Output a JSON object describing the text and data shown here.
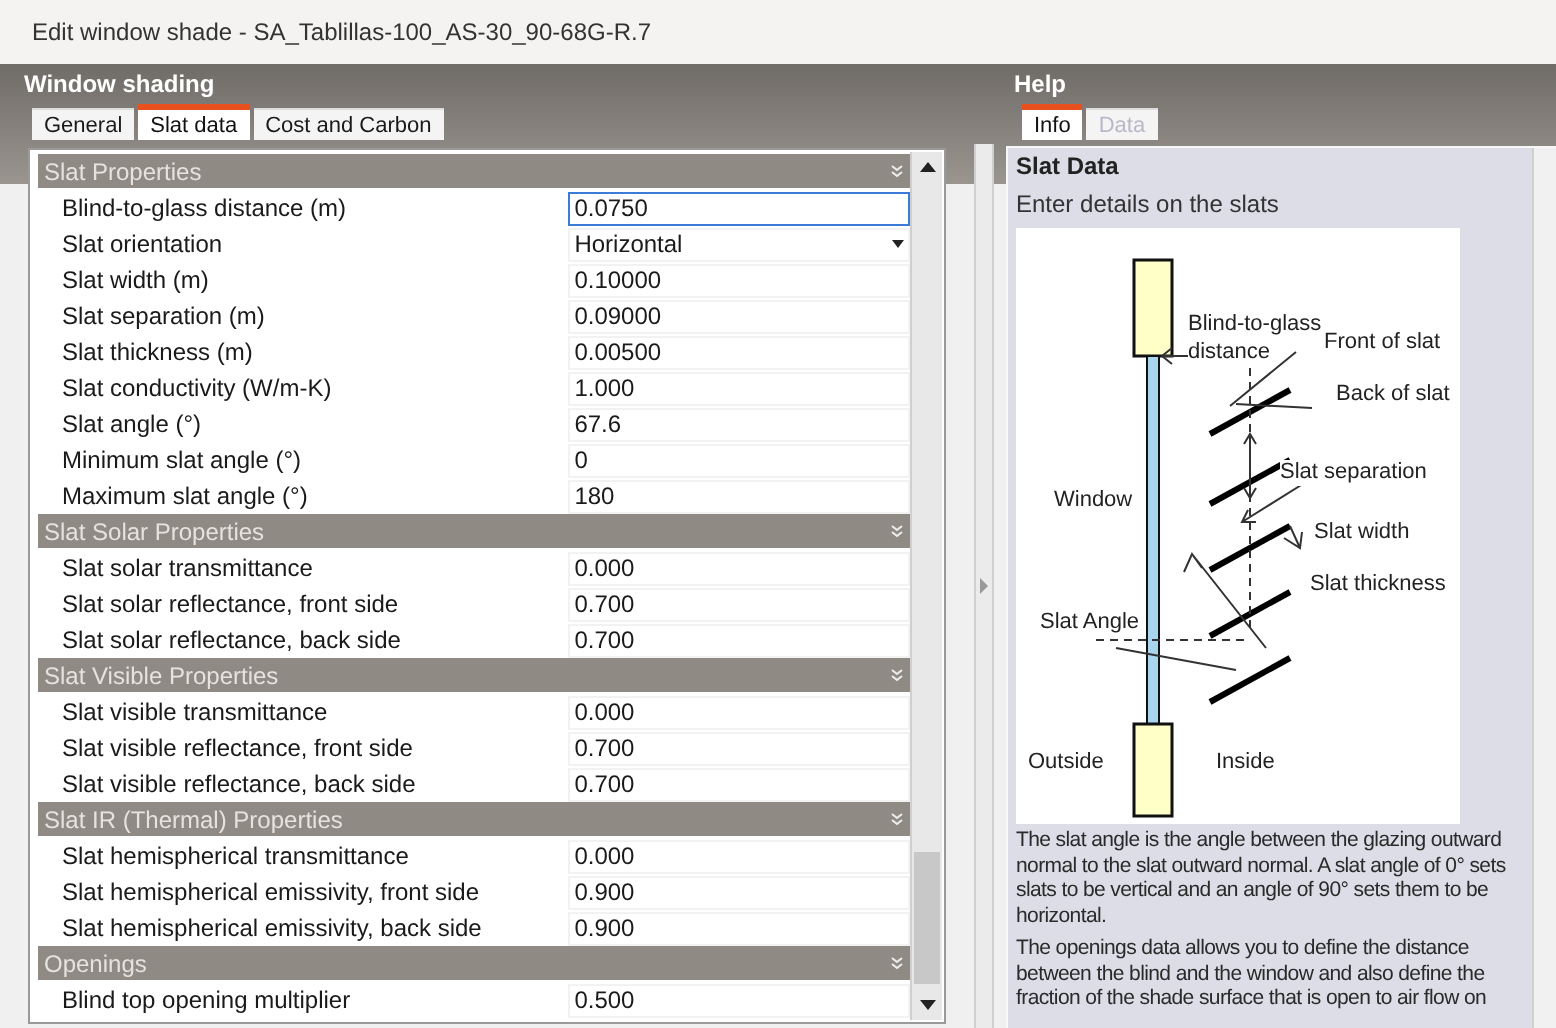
{
  "window": {
    "title": "Edit window shade - SA_Tablillas-100_AS-30_90-68G-R.7"
  },
  "left_panel": {
    "title": "Window shading",
    "tabs": [
      {
        "label": "General",
        "selected": false
      },
      {
        "label": "Slat data",
        "selected": true
      },
      {
        "label": "Cost and Carbon",
        "selected": false
      }
    ],
    "sections": [
      {
        "title": "Slat Properties",
        "rows": [
          {
            "label": "Blind-to-glass distance (m)",
            "value": "0.0750",
            "kind": "text",
            "focused": true
          },
          {
            "label": "Slat orientation",
            "value": "Horizontal",
            "kind": "dropdown",
            "focused": false
          },
          {
            "label": "Slat width (m)",
            "value": "0.10000",
            "kind": "text",
            "focused": false
          },
          {
            "label": "Slat separation (m)",
            "value": "0.09000",
            "kind": "text",
            "focused": false
          },
          {
            "label": "Slat thickness (m)",
            "value": "0.00500",
            "kind": "text",
            "focused": false
          },
          {
            "label": "Slat conductivity (W/m-K)",
            "value": "1.000",
            "kind": "text",
            "focused": false
          },
          {
            "label": "Slat angle (°)",
            "value": "67.6",
            "kind": "text",
            "focused": false
          },
          {
            "label": "Minimum slat angle (°)",
            "value": "0",
            "kind": "text",
            "focused": false
          },
          {
            "label": "Maximum slat angle (°)",
            "value": "180",
            "kind": "text",
            "focused": false
          }
        ]
      },
      {
        "title": "Slat Solar Properties",
        "rows": [
          {
            "label": "Slat solar transmittance",
            "value": "0.000",
            "kind": "text",
            "focused": false
          },
          {
            "label": "Slat solar reflectance, front side",
            "value": "0.700",
            "kind": "text",
            "focused": false
          },
          {
            "label": "Slat solar reflectance, back side",
            "value": "0.700",
            "kind": "text",
            "focused": false
          }
        ]
      },
      {
        "title": "Slat Visible Properties",
        "rows": [
          {
            "label": "Slat visible transmittance",
            "value": "0.000",
            "kind": "text",
            "focused": false
          },
          {
            "label": "Slat visible reflectance, front side",
            "value": "0.700",
            "kind": "text",
            "focused": false
          },
          {
            "label": "Slat visible reflectance, back side",
            "value": "0.700",
            "kind": "text",
            "focused": false
          }
        ]
      },
      {
        "title": "Slat IR (Thermal) Properties",
        "rows": [
          {
            "label": "Slat hemispherical transmittance",
            "value": "0.000",
            "kind": "text",
            "focused": false
          },
          {
            "label": "Slat hemispherical emissivity, front side",
            "value": "0.900",
            "kind": "text",
            "focused": false
          },
          {
            "label": "Slat hemispherical emissivity, back side",
            "value": "0.900",
            "kind": "text",
            "focused": false
          }
        ]
      },
      {
        "title": "Openings",
        "rows": [
          {
            "label": "Blind top opening multiplier",
            "value": "0.500",
            "kind": "text",
            "focused": false
          }
        ]
      }
    ]
  },
  "help_panel": {
    "title": "Help",
    "tabs": [
      {
        "label": "Info",
        "selected": true,
        "disabled": false
      },
      {
        "label": "Data",
        "selected": false,
        "disabled": true
      }
    ],
    "heading": "Slat Data",
    "intro": "Enter details on the slats",
    "diagram_labels": [
      "Blind-to-glass",
      "distance",
      "Front of slat",
      "Back of slat",
      "Slat separation",
      "Window",
      "Slat width",
      "Slat thickness",
      "Slat Angle",
      "Outside",
      "Inside"
    ],
    "paragraphs": [
      "The slat angle is the angle between the glazing outward normal to the slat outward normal.  A slat angle of 0° sets slats to be vertical and an angle of 90° sets them to be horizontal.",
      "The openings data allows you to define the distance between the blind and the window and also define the fraction of the shade surface that is open to air flow on"
    ]
  }
}
